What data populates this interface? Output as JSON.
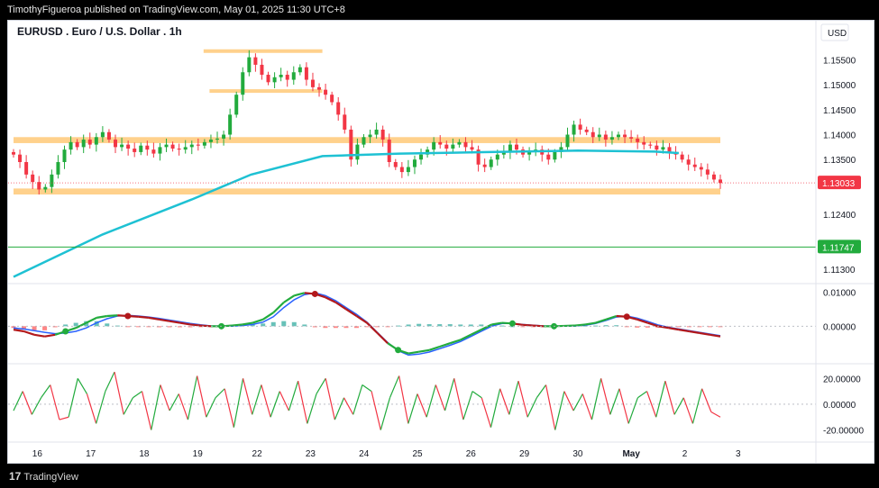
{
  "header": {
    "publish_line": "TimothyFigueroa published on TradingView.com, May 01, 2025 11:30 UTC+8"
  },
  "footer": {
    "brand": "TradingView",
    "brand_mark": "17"
  },
  "chart_data": {
    "type": "candlestick",
    "title": "EURUSD . Euro / U.S. Dollar . 1h",
    "currency_label": "USD",
    "price_axis_ticks": [
      "1.15500",
      "1.15000",
      "1.14500",
      "1.14000",
      "1.13500",
      "1.12400",
      "1.11300"
    ],
    "price_axis_tick_values": [
      1.155,
      1.15,
      1.145,
      1.14,
      1.135,
      1.124,
      1.113
    ],
    "price_ylim": [
      1.1105,
      1.1585
    ],
    "last_price": {
      "label": "1.13033",
      "value": 1.13033,
      "color": "#f23645"
    },
    "horizontal_line": {
      "label": "1.11747",
      "value": 1.11747,
      "color": "#22ab3d"
    },
    "x_tick_labels": [
      "16",
      "17",
      "18",
      "19",
      "22",
      "23",
      "24",
      "25",
      "26",
      "29",
      "30",
      "May",
      "2",
      "3"
    ],
    "x_domain_bars": [
      0,
      119
    ],
    "x_tick_bars": [
      4,
      13,
      22,
      31,
      41,
      50,
      59,
      68,
      77,
      86,
      95,
      104,
      113,
      122
    ],
    "zones": [
      {
        "from": 1.1383,
        "to": 1.1395,
        "start_bar": 0,
        "end_bar": 119
      },
      {
        "from": 1.128,
        "to": 1.1292,
        "start_bar": 0,
        "end_bar": 119
      },
      {
        "from": 1.1565,
        "to": 1.1571,
        "start_bar": 32,
        "end_bar": 52
      },
      {
        "from": 1.1485,
        "to": 1.1491,
        "start_bar": 33,
        "end_bar": 52
      }
    ],
    "close_series": [
      1.136,
      1.1345,
      1.132,
      1.1305,
      1.129,
      1.1295,
      1.132,
      1.1345,
      1.137,
      1.1385,
      1.1375,
      1.139,
      1.138,
      1.1395,
      1.1405,
      1.139,
      1.1375,
      1.138,
      1.1372,
      1.1365,
      1.1378,
      1.137,
      1.1362,
      1.1375,
      1.138,
      1.1372,
      1.137,
      1.1375,
      1.138,
      1.1378,
      1.1385,
      1.139,
      1.1392,
      1.14,
      1.144,
      1.148,
      1.1525,
      1.1555,
      1.154,
      1.152,
      1.1505,
      1.1515,
      1.152,
      1.151,
      1.1525,
      1.1535,
      1.151,
      1.1495,
      1.149,
      1.148,
      1.1465,
      1.144,
      1.141,
      1.135,
      1.138,
      1.1395,
      1.14,
      1.141,
      1.139,
      1.1345,
      1.1335,
      1.1325,
      1.1335,
      1.135,
      1.136,
      1.137,
      1.1385,
      1.138,
      1.1372,
      1.138,
      1.1385,
      1.1375,
      1.137,
      1.134,
      1.1335,
      1.135,
      1.136,
      1.1365,
      1.138,
      1.137,
      1.136,
      1.1365,
      1.137,
      1.136,
      1.135,
      1.1365,
      1.1375,
      1.14,
      1.142,
      1.141,
      1.1405,
      1.1395,
      1.14,
      1.139,
      1.1395,
      1.14,
      1.1395,
      1.1392,
      1.1385,
      1.138,
      1.1378,
      1.137,
      1.1375,
      1.1365,
      1.136,
      1.135,
      1.134,
      1.1335,
      1.133,
      1.132,
      1.131,
      1.1303
    ],
    "ma_series": {
      "color": "#1ec1d3",
      "values": [
        1.1115,
        1.12,
        1.127,
        1.132,
        1.1357,
        1.1362,
        1.1365,
        1.1368,
        1.1366,
        1.1363
      ],
      "bars": [
        0,
        15,
        30,
        40,
        52,
        65,
        80,
        95,
        108,
        112
      ]
    },
    "macd": {
      "ticks": [
        "0.01000",
        "0.00000"
      ],
      "tick_values": [
        0.01,
        0.0
      ],
      "ylim": [
        -0.0105,
        0.012
      ],
      "macd_line": [
        -0.001,
        -0.0015,
        -0.0025,
        -0.003,
        -0.0025,
        -0.0015,
        -0.0005,
        0.001,
        0.0025,
        0.003,
        0.0032,
        0.003,
        0.0028,
        0.0025,
        0.002,
        0.0015,
        0.001,
        0.0005,
        0.0002,
        0.0,
        0.0,
        0.0002,
        0.0005,
        0.001,
        0.002,
        0.004,
        0.007,
        0.009,
        0.0098,
        0.0095,
        0.0085,
        0.007,
        0.005,
        0.003,
        0.001,
        -0.002,
        -0.005,
        -0.007,
        -0.008,
        -0.0075,
        -0.007,
        -0.006,
        -0.005,
        -0.004,
        -0.0025,
        -0.001,
        0.0005,
        0.001,
        0.0008,
        0.0004,
        0.0002,
        0.0,
        0.0,
        0.0001,
        0.0002,
        0.0005,
        0.001,
        0.002,
        0.003,
        0.0028,
        0.002,
        0.001,
        0.0,
        -0.0005,
        -0.001,
        -0.0015,
        -0.002,
        -0.0025,
        -0.003
      ],
      "signal_line": [
        -0.0005,
        -0.0008,
        -0.0013,
        -0.0018,
        -0.0022,
        -0.002,
        -0.0015,
        -0.0005,
        0.001,
        0.0022,
        0.003,
        0.0032,
        0.003,
        0.0027,
        0.0023,
        0.0018,
        0.0013,
        0.0008,
        0.0004,
        0.0001,
        0.0,
        0.0,
        0.0002,
        0.0005,
        0.0012,
        0.0028,
        0.0055,
        0.0078,
        0.0093,
        0.0098,
        0.009,
        0.0075,
        0.0055,
        0.0035,
        0.0012,
        -0.0018,
        -0.0048,
        -0.0072,
        -0.0085,
        -0.0082,
        -0.0076,
        -0.0066,
        -0.0056,
        -0.0045,
        -0.003,
        -0.0015,
        0.0,
        0.0008,
        0.0008,
        0.0005,
        0.0003,
        0.0001,
        0.0,
        0.0,
        0.0001,
        0.0003,
        0.0008,
        0.0017,
        0.0027,
        0.003,
        0.0024,
        0.0014,
        0.0004,
        -0.0003,
        -0.0008,
        -0.0013,
        -0.0018,
        -0.0023,
        -0.0028
      ],
      "histogram": [
        -0.0005,
        -0.0008,
        -0.0012,
        -0.0012,
        -0.0003,
        0.0005,
        0.001,
        0.0015,
        0.0015,
        0.0008,
        0.0002,
        -0.0002,
        -0.0002,
        -0.0002,
        -0.0003,
        -0.0003,
        -0.0003,
        -0.0003,
        -0.0002,
        -0.0001,
        0.0,
        0.0002,
        0.0003,
        0.0005,
        0.0008,
        0.0012,
        0.0015,
        0.0012,
        0.0005,
        -0.0003,
        -0.0005,
        -0.0005,
        -0.0005,
        -0.0005,
        -0.0002,
        -0.0002,
        -0.0002,
        0.0002,
        0.0005,
        0.0007,
        0.0006,
        0.0006,
        0.0006,
        0.0005,
        0.0005,
        0.0005,
        0.0005,
        0.0002,
        0.0,
        -0.0001,
        -0.0001,
        -0.0001,
        0.0,
        0.0001,
        0.0001,
        0.0002,
        0.0002,
        0.0003,
        0.0003,
        -0.0002,
        -0.0004,
        -0.0004,
        -0.0004,
        -0.0002,
        -0.0002,
        -0.0002,
        -0.0002,
        -0.0002,
        -0.0002
      ],
      "line_color_up": "#22ab3d",
      "line_color_down": "#b2181b",
      "signal_color": "#2962ff"
    },
    "oscillator": {
      "ticks": [
        "20.00000",
        "0.00000",
        "-20.00000"
      ],
      "tick_values": [
        20,
        0,
        -20
      ],
      "ylim": [
        -28,
        30
      ],
      "values": [
        -5,
        10,
        -8,
        5,
        15,
        -12,
        -10,
        20,
        8,
        -15,
        10,
        25,
        -8,
        5,
        10,
        -20,
        15,
        -5,
        8,
        -12,
        22,
        -10,
        5,
        12,
        -18,
        20,
        -8,
        15,
        -10,
        10,
        -5,
        18,
        -15,
        8,
        20,
        -12,
        5,
        -8,
        15,
        10,
        -20,
        5,
        22,
        -15,
        8,
        -10,
        15,
        -5,
        20,
        -12,
        10,
        5,
        -18,
        12,
        -8,
        18,
        -10,
        5,
        15,
        -20,
        10,
        -5,
        8,
        -12,
        20,
        -8,
        12,
        -15,
        5,
        10,
        -10,
        18,
        -8,
        5,
        -15,
        12,
        -6,
        -10
      ],
      "color_up": "#22ab3d",
      "color_down": "#f23645"
    }
  }
}
